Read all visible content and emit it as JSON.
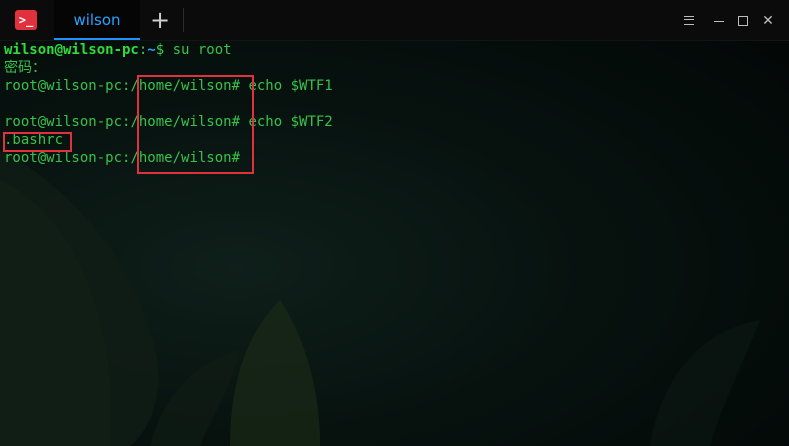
{
  "titlebar": {
    "app_icon": ">_",
    "tab_label": "wilson",
    "new_tab_icon": "+",
    "controls": {
      "menu_icon": "hamburger-icon",
      "minimize_icon": "minimize-icon",
      "maximize_icon": "maximize-icon",
      "close_icon": "close-icon",
      "close_symbol": "✕"
    }
  },
  "terminal": {
    "line1": {
      "user": "wilson@wilson-pc",
      "colon": ":",
      "dir": "~",
      "prompt": "$ ",
      "cmd": "su root"
    },
    "line2": {
      "text": "密码："
    },
    "line3": {
      "prompt": "root@wilson-pc:",
      "dir": "/home/wilson#",
      "cmd": " echo $WTF1"
    },
    "line5": {
      "prompt": "root@wilson-pc:",
      "dir": "/home/wilson#",
      "cmd": " echo $WTF2"
    },
    "line6": {
      "text": ".bashrc"
    },
    "line7": {
      "prompt": "root@wilson-pc:",
      "dir": "/home/wilson#"
    }
  },
  "colors": {
    "accent": "#1e90ff",
    "terminal_green": "#3ccf4a",
    "highlight_red": "#e0313c"
  }
}
